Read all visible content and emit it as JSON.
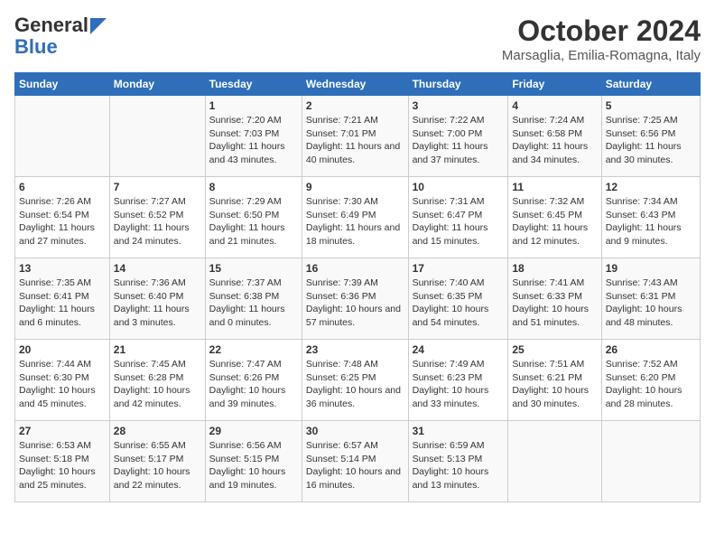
{
  "logo": {
    "line1": "General",
    "line2": "Blue"
  },
  "title": "October 2024",
  "location": "Marsaglia, Emilia-Romagna, Italy",
  "weekdays": [
    "Sunday",
    "Monday",
    "Tuesday",
    "Wednesday",
    "Thursday",
    "Friday",
    "Saturday"
  ],
  "weeks": [
    [
      {
        "day": "",
        "sunrise": "",
        "sunset": "",
        "daylight": ""
      },
      {
        "day": "",
        "sunrise": "",
        "sunset": "",
        "daylight": ""
      },
      {
        "day": "1",
        "sunrise": "Sunrise: 7:20 AM",
        "sunset": "Sunset: 7:03 PM",
        "daylight": "Daylight: 11 hours and 43 minutes."
      },
      {
        "day": "2",
        "sunrise": "Sunrise: 7:21 AM",
        "sunset": "Sunset: 7:01 PM",
        "daylight": "Daylight: 11 hours and 40 minutes."
      },
      {
        "day": "3",
        "sunrise": "Sunrise: 7:22 AM",
        "sunset": "Sunset: 7:00 PM",
        "daylight": "Daylight: 11 hours and 37 minutes."
      },
      {
        "day": "4",
        "sunrise": "Sunrise: 7:24 AM",
        "sunset": "Sunset: 6:58 PM",
        "daylight": "Daylight: 11 hours and 34 minutes."
      },
      {
        "day": "5",
        "sunrise": "Sunrise: 7:25 AM",
        "sunset": "Sunset: 6:56 PM",
        "daylight": "Daylight: 11 hours and 30 minutes."
      }
    ],
    [
      {
        "day": "6",
        "sunrise": "Sunrise: 7:26 AM",
        "sunset": "Sunset: 6:54 PM",
        "daylight": "Daylight: 11 hours and 27 minutes."
      },
      {
        "day": "7",
        "sunrise": "Sunrise: 7:27 AM",
        "sunset": "Sunset: 6:52 PM",
        "daylight": "Daylight: 11 hours and 24 minutes."
      },
      {
        "day": "8",
        "sunrise": "Sunrise: 7:29 AM",
        "sunset": "Sunset: 6:50 PM",
        "daylight": "Daylight: 11 hours and 21 minutes."
      },
      {
        "day": "9",
        "sunrise": "Sunrise: 7:30 AM",
        "sunset": "Sunset: 6:49 PM",
        "daylight": "Daylight: 11 hours and 18 minutes."
      },
      {
        "day": "10",
        "sunrise": "Sunrise: 7:31 AM",
        "sunset": "Sunset: 6:47 PM",
        "daylight": "Daylight: 11 hours and 15 minutes."
      },
      {
        "day": "11",
        "sunrise": "Sunrise: 7:32 AM",
        "sunset": "Sunset: 6:45 PM",
        "daylight": "Daylight: 11 hours and 12 minutes."
      },
      {
        "day": "12",
        "sunrise": "Sunrise: 7:34 AM",
        "sunset": "Sunset: 6:43 PM",
        "daylight": "Daylight: 11 hours and 9 minutes."
      }
    ],
    [
      {
        "day": "13",
        "sunrise": "Sunrise: 7:35 AM",
        "sunset": "Sunset: 6:41 PM",
        "daylight": "Daylight: 11 hours and 6 minutes."
      },
      {
        "day": "14",
        "sunrise": "Sunrise: 7:36 AM",
        "sunset": "Sunset: 6:40 PM",
        "daylight": "Daylight: 11 hours and 3 minutes."
      },
      {
        "day": "15",
        "sunrise": "Sunrise: 7:37 AM",
        "sunset": "Sunset: 6:38 PM",
        "daylight": "Daylight: 11 hours and 0 minutes."
      },
      {
        "day": "16",
        "sunrise": "Sunrise: 7:39 AM",
        "sunset": "Sunset: 6:36 PM",
        "daylight": "Daylight: 10 hours and 57 minutes."
      },
      {
        "day": "17",
        "sunrise": "Sunrise: 7:40 AM",
        "sunset": "Sunset: 6:35 PM",
        "daylight": "Daylight: 10 hours and 54 minutes."
      },
      {
        "day": "18",
        "sunrise": "Sunrise: 7:41 AM",
        "sunset": "Sunset: 6:33 PM",
        "daylight": "Daylight: 10 hours and 51 minutes."
      },
      {
        "day": "19",
        "sunrise": "Sunrise: 7:43 AM",
        "sunset": "Sunset: 6:31 PM",
        "daylight": "Daylight: 10 hours and 48 minutes."
      }
    ],
    [
      {
        "day": "20",
        "sunrise": "Sunrise: 7:44 AM",
        "sunset": "Sunset: 6:30 PM",
        "daylight": "Daylight: 10 hours and 45 minutes."
      },
      {
        "day": "21",
        "sunrise": "Sunrise: 7:45 AM",
        "sunset": "Sunset: 6:28 PM",
        "daylight": "Daylight: 10 hours and 42 minutes."
      },
      {
        "day": "22",
        "sunrise": "Sunrise: 7:47 AM",
        "sunset": "Sunset: 6:26 PM",
        "daylight": "Daylight: 10 hours and 39 minutes."
      },
      {
        "day": "23",
        "sunrise": "Sunrise: 7:48 AM",
        "sunset": "Sunset: 6:25 PM",
        "daylight": "Daylight: 10 hours and 36 minutes."
      },
      {
        "day": "24",
        "sunrise": "Sunrise: 7:49 AM",
        "sunset": "Sunset: 6:23 PM",
        "daylight": "Daylight: 10 hours and 33 minutes."
      },
      {
        "day": "25",
        "sunrise": "Sunrise: 7:51 AM",
        "sunset": "Sunset: 6:21 PM",
        "daylight": "Daylight: 10 hours and 30 minutes."
      },
      {
        "day": "26",
        "sunrise": "Sunrise: 7:52 AM",
        "sunset": "Sunset: 6:20 PM",
        "daylight": "Daylight: 10 hours and 28 minutes."
      }
    ],
    [
      {
        "day": "27",
        "sunrise": "Sunrise: 6:53 AM",
        "sunset": "Sunset: 5:18 PM",
        "daylight": "Daylight: 10 hours and 25 minutes."
      },
      {
        "day": "28",
        "sunrise": "Sunrise: 6:55 AM",
        "sunset": "Sunset: 5:17 PM",
        "daylight": "Daylight: 10 hours and 22 minutes."
      },
      {
        "day": "29",
        "sunrise": "Sunrise: 6:56 AM",
        "sunset": "Sunset: 5:15 PM",
        "daylight": "Daylight: 10 hours and 19 minutes."
      },
      {
        "day": "30",
        "sunrise": "Sunrise: 6:57 AM",
        "sunset": "Sunset: 5:14 PM",
        "daylight": "Daylight: 10 hours and 16 minutes."
      },
      {
        "day": "31",
        "sunrise": "Sunrise: 6:59 AM",
        "sunset": "Sunset: 5:13 PM",
        "daylight": "Daylight: 10 hours and 13 minutes."
      },
      {
        "day": "",
        "sunrise": "",
        "sunset": "",
        "daylight": ""
      },
      {
        "day": "",
        "sunrise": "",
        "sunset": "",
        "daylight": ""
      }
    ]
  ]
}
